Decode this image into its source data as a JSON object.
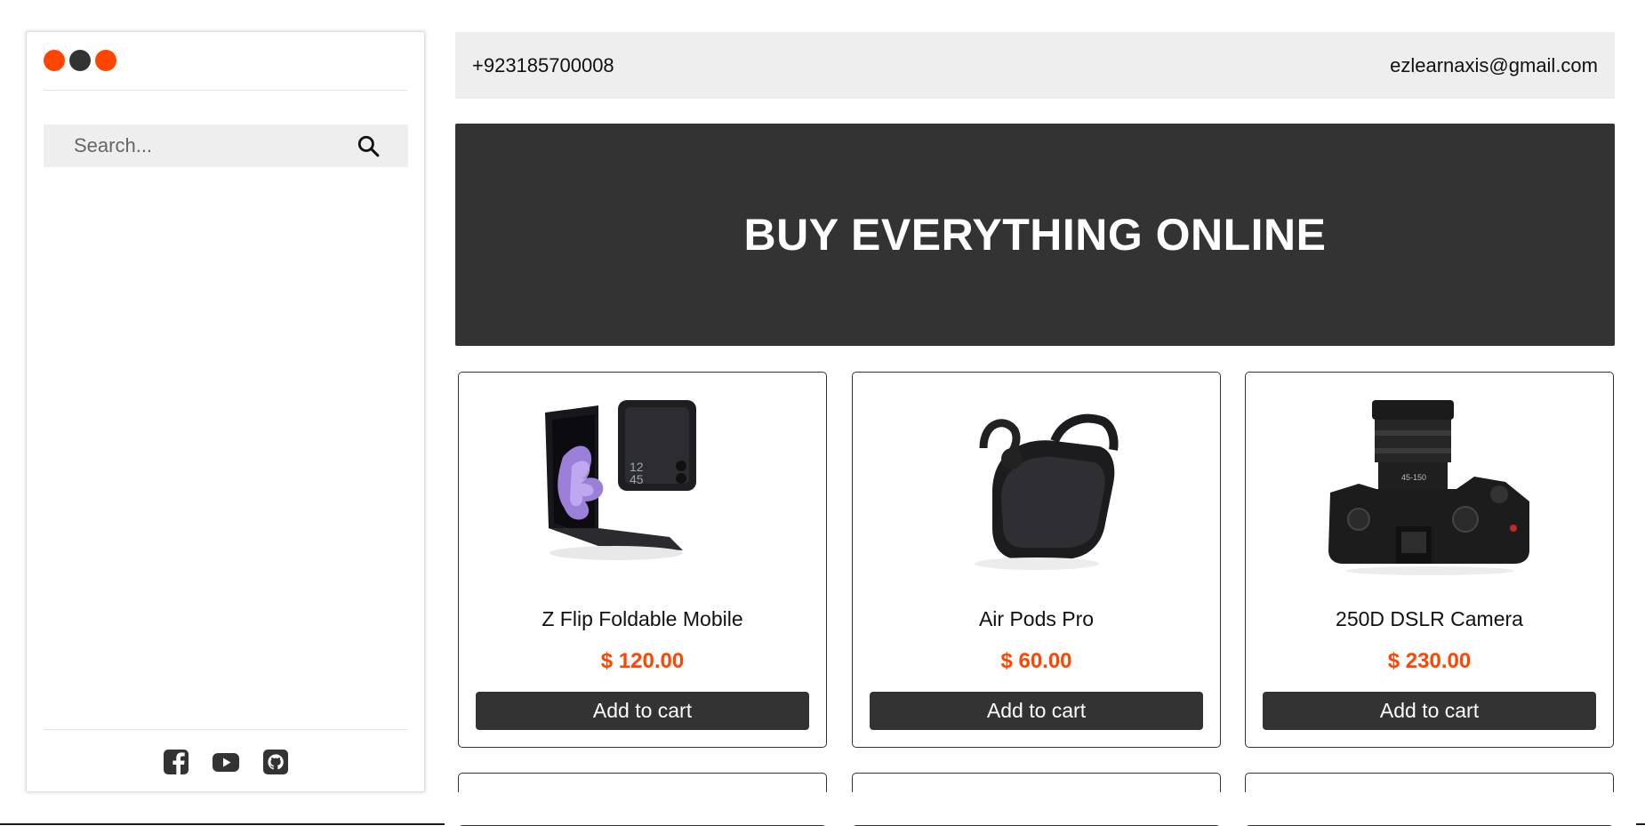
{
  "brand": {
    "logo_dot_colors": [
      "#ff4500",
      "#333333",
      "#ff4500"
    ]
  },
  "search": {
    "placeholder": "Search...",
    "icon": "search-icon"
  },
  "social": [
    {
      "icon": "facebook-icon"
    },
    {
      "icon": "youtube-icon"
    },
    {
      "icon": "github-icon"
    }
  ],
  "contact": {
    "phone": "+923185700008",
    "email": "ezlearnaxis@gmail.com"
  },
  "hero": {
    "title": "BUY EVERYTHING ONLINE"
  },
  "products": [
    {
      "name": "Z Flip Foldable Mobile",
      "price": "$ 120.00",
      "button": "Add to cart",
      "image": "foldable-phone-image"
    },
    {
      "name": "Air Pods Pro",
      "price": "$ 60.00",
      "button": "Add to cart",
      "image": "earbuds-image"
    },
    {
      "name": "250D DSLR Camera",
      "price": "$ 230.00",
      "button": "Add to cart",
      "image": "camera-image"
    }
  ],
  "colors": {
    "accent": "#ff4500",
    "dark": "#333333",
    "bar": "#eeeeee"
  }
}
